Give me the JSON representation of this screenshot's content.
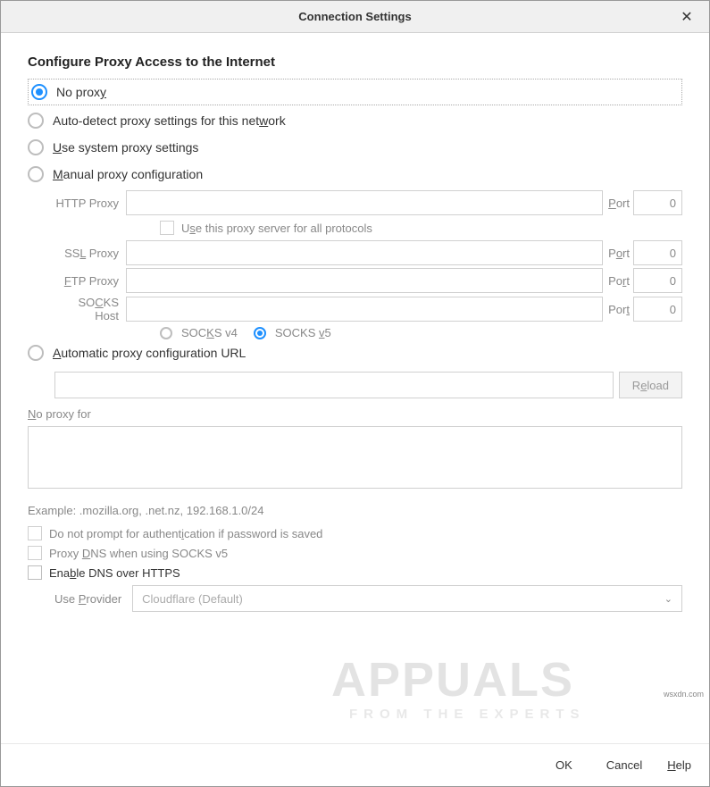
{
  "title": "Connection Settings",
  "heading": "Configure Proxy Access to the Internet",
  "options": {
    "no_proxy": "No proxy",
    "no_proxy_u": "y",
    "auto_detect": "Auto-detect proxy settings for this network",
    "auto_detect_u": "w",
    "use_system": "Use system proxy settings",
    "use_system_u": "U",
    "manual": "Manual proxy configuration",
    "manual_u": "M",
    "auto_url": "Automatic proxy configuration URL",
    "auto_url_u": "A"
  },
  "selected": "no_proxy",
  "manual": {
    "http_label": "HTTP Proxy",
    "http_value": "",
    "http_port_label": "Port",
    "http_port_u": "P",
    "http_port_value": "0",
    "use_all_label": "Use this proxy server for all protocols",
    "use_all_u": "s",
    "use_all_checked": false,
    "ssl_label": "SSL Proxy",
    "ssl_label_u": "L",
    "ssl_value": "",
    "ssl_port_label": "Port",
    "ssl_port_u": "o",
    "ssl_port_value": "0",
    "ftp_label": "FTP Proxy",
    "ftp_label_u": "F",
    "ftp_value": "",
    "ftp_port_label": "Port",
    "ftp_port_u": "r",
    "ftp_port_value": "0",
    "socks_label": "SOCKS Host",
    "socks_label_u": "C",
    "socks_value": "",
    "socks_port_label": "Port",
    "socks_port_u": "t",
    "socks_port_value": "0",
    "socks_v4": "SOCKS v4",
    "socks_v4_u": "K",
    "socks_v5": "SOCKS v5",
    "socks_v5_u": "v",
    "socks_version_selected": "v5"
  },
  "auto_url_value": "",
  "reload_label": "Reload",
  "reload_u": "e",
  "no_proxy_for_label": "No proxy for",
  "no_proxy_for_u": "N",
  "no_proxy_for_value": "",
  "example": "Example: .mozilla.org, .net.nz, 192.168.1.0/24",
  "checkboxes": {
    "no_auth_prompt": "Do not prompt for authentication if password is saved",
    "no_auth_u": "i",
    "no_auth_checked": false,
    "proxy_dns": "Proxy DNS when using SOCKS v5",
    "proxy_dns_u": "D",
    "proxy_dns_checked": false,
    "enable_doh": "Enable DNS over HTTPS",
    "enable_doh_u": "b",
    "enable_doh_checked": false
  },
  "provider": {
    "label": "Use Provider",
    "label_u": "P",
    "value": "Cloudflare (Default)"
  },
  "buttons": {
    "ok": "OK",
    "cancel": "Cancel",
    "help": "Help",
    "help_u": "H"
  },
  "watermark": "APPUALS",
  "watermark_sub": "FROM THE EXPERTS",
  "attribution": "wsxdn.com"
}
